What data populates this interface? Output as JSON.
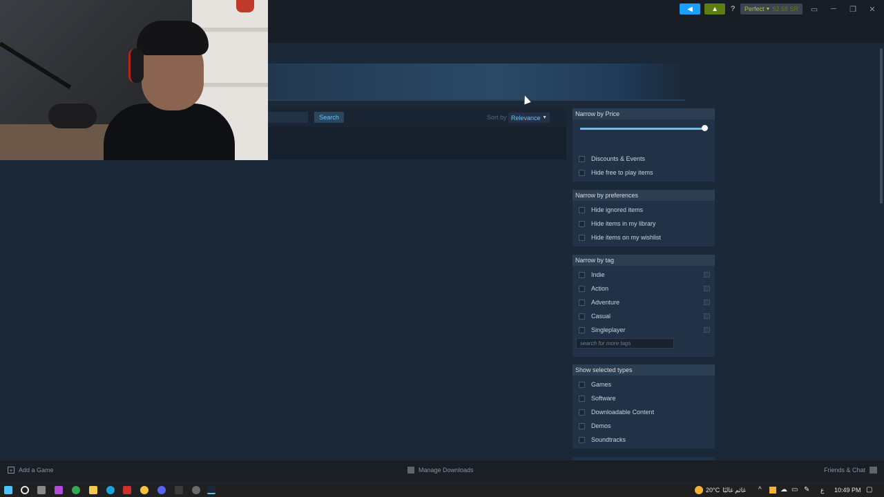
{
  "titlebar": {
    "account_name": "Perfect",
    "wallet": "52.58 SR",
    "help": "?",
    "minimize": "─",
    "maximize": "❐",
    "close": "✕",
    "colors": {
      "announce": "#1a9fff",
      "notifications": "#5c7e10"
    }
  },
  "search": {
    "input_value": "",
    "button_label": "Search",
    "sort_label": "Sort by",
    "sort_value": "Relevance"
  },
  "price": {
    "header": "Narrow by Price",
    "slider_value_fraction": 1.0,
    "options": [
      "Discounts & Events",
      "Hide free to play items"
    ]
  },
  "preferences": {
    "header": "Narrow by preferences",
    "options": [
      "Hide ignored items",
      "Hide items in my library",
      "Hide items on my wishlist"
    ]
  },
  "tags": {
    "header": "Narrow by tag",
    "options": [
      "Indie",
      "Action",
      "Adventure",
      "Casual",
      "Singleplayer"
    ],
    "search_placeholder": "search for more tags"
  },
  "types": {
    "header": "Show selected types",
    "options": [
      "Games",
      "Software",
      "Downloadable Content",
      "Demos",
      "Soundtracks"
    ]
  },
  "bottom": {
    "add_game": "Add a Game",
    "manage_downloads": "Manage Downloads",
    "friends_chat": "Friends & Chat"
  },
  "taskbar": {
    "weather_temp": "20°C",
    "weather_text": "غائم غالبًا",
    "lang": "ع",
    "time": "10:49 PM"
  }
}
